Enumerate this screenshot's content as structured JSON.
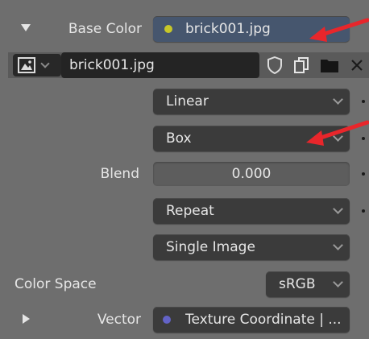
{
  "base_color": {
    "label": "Base Color",
    "value": "brick001.jpg",
    "socket_color": "#c7c729"
  },
  "image_block": {
    "filename": "brick001.jpg"
  },
  "interpolation": {
    "value": "Linear"
  },
  "projection": {
    "value": "Box"
  },
  "blend": {
    "label": "Blend",
    "value": "0.000"
  },
  "extension": {
    "value": "Repeat"
  },
  "source": {
    "value": "Single Image"
  },
  "color_space": {
    "label": "Color Space",
    "value": "sRGB"
  },
  "vector": {
    "label": "Vector",
    "value": "Texture Coordinate | ...",
    "socket_color": "#6363c7"
  },
  "annotation_color": "#e8262b"
}
